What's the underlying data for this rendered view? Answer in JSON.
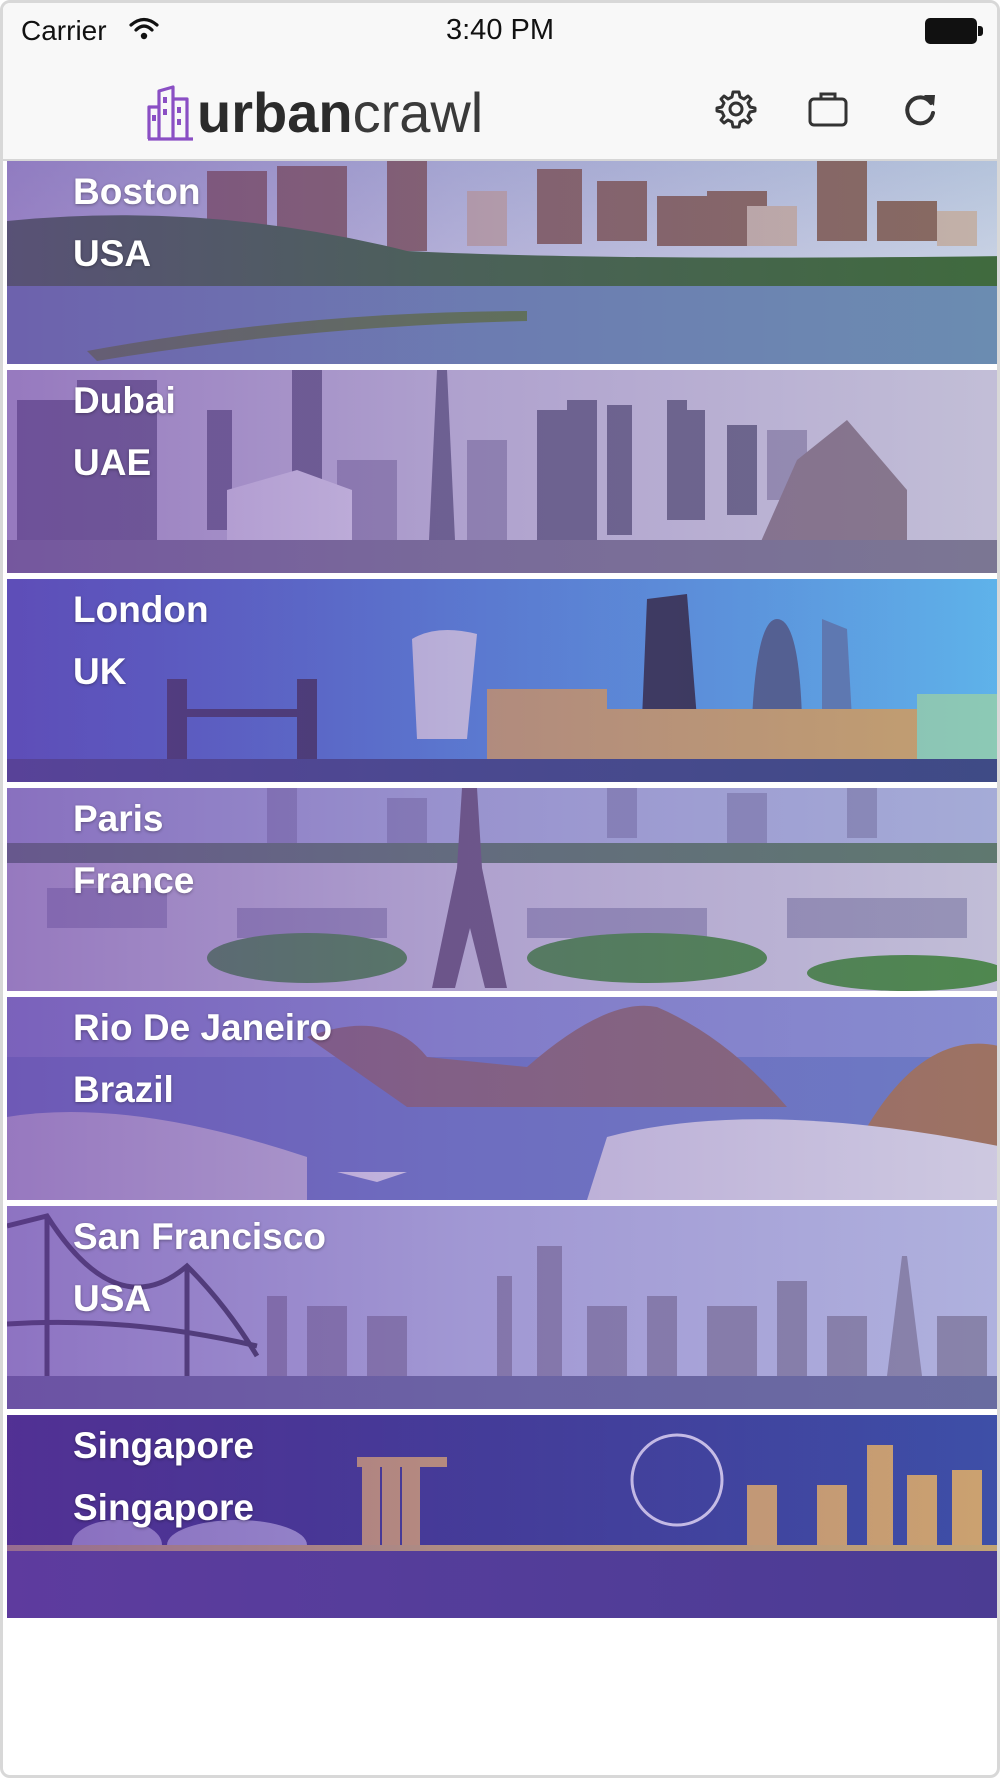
{
  "status_bar": {
    "carrier": "Carrier",
    "time": "3:40 PM"
  },
  "nav": {
    "logo_bold": "urban",
    "logo_light": "crawl",
    "icons": [
      "gear-icon",
      "briefcase-icon",
      "refresh-icon"
    ],
    "brand_color": "#8a4fc4"
  },
  "cities": [
    {
      "name": "Boston",
      "country": "USA"
    },
    {
      "name": "Dubai",
      "country": "UAE"
    },
    {
      "name": "London",
      "country": "UK"
    },
    {
      "name": "Paris",
      "country": "France"
    },
    {
      "name": "Rio De Janeiro",
      "country": "Brazil"
    },
    {
      "name": "San Francisco",
      "country": "USA"
    },
    {
      "name": "Singapore",
      "country": "Singapore"
    }
  ]
}
